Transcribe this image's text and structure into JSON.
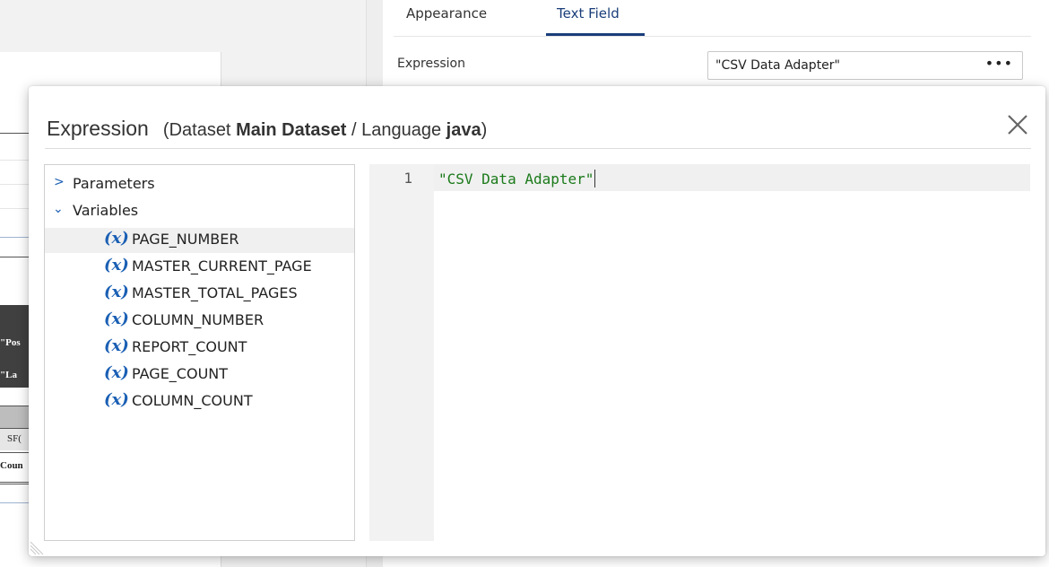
{
  "props": {
    "tabs": [
      {
        "label": "Appearance",
        "active": false
      },
      {
        "label": "Text Field",
        "active": true
      }
    ],
    "expression_label": "Expression",
    "expression_value": "\"CSV Data Adapter\"",
    "more_button": "•••"
  },
  "background": {
    "band_texts": [
      "\"Pos",
      "\"La",
      "SF(",
      "Coun"
    ]
  },
  "dialog": {
    "title": "Expression",
    "sub_prefix": "(Dataset ",
    "dataset": "Main Dataset",
    "sub_mid": " / Language ",
    "language": "java",
    "sub_suffix": ")",
    "close_icon": "close-icon",
    "tree": {
      "parameters": "Parameters",
      "variables": "Variables",
      "variable_glyph": "(x)",
      "variable_items": [
        "PAGE_NUMBER",
        "MASTER_CURRENT_PAGE",
        "MASTER_TOTAL_PAGES",
        "COLUMN_NUMBER",
        "REPORT_COUNT",
        "PAGE_COUNT",
        "COLUMN_COUNT"
      ]
    },
    "editor": {
      "line_number": "1",
      "code": "\"CSV Data Adapter\""
    }
  },
  "colors": {
    "accent": "#1a3e7a",
    "var_icon": "#1a5fb4",
    "string_literal": "#1a7a1a"
  }
}
